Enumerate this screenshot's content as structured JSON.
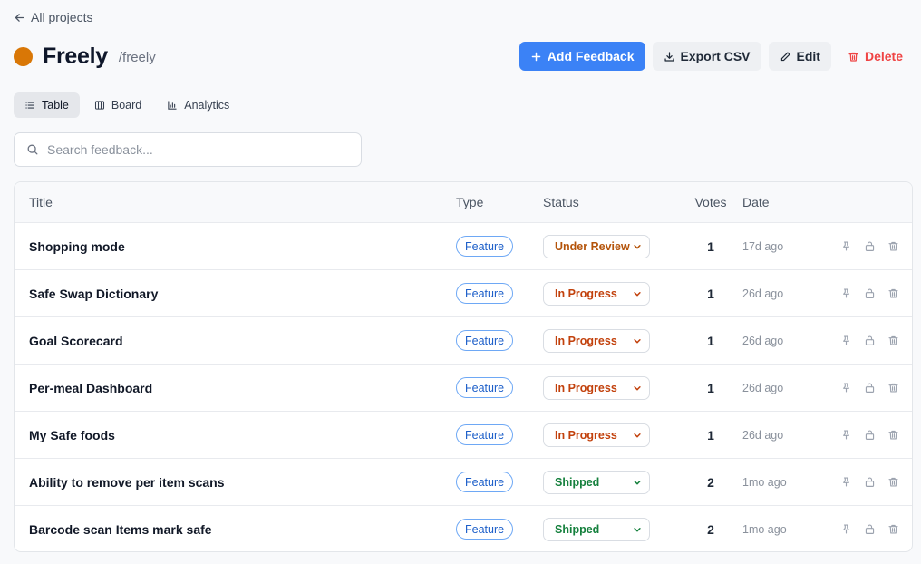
{
  "nav": {
    "back_label": "All projects"
  },
  "project": {
    "name": "Freely",
    "slug": "/freely",
    "color": "#d97706"
  },
  "actions": {
    "add_label": "Add Feedback",
    "export_label": "Export CSV",
    "edit_label": "Edit",
    "delete_label": "Delete"
  },
  "views": {
    "table": "Table",
    "board": "Board",
    "analytics": "Analytics",
    "active": "Table"
  },
  "search": {
    "placeholder": "Search feedback...",
    "value": ""
  },
  "table": {
    "headers": {
      "title": "Title",
      "type": "Type",
      "status": "Status",
      "votes": "Votes",
      "date": "Date"
    },
    "rows": [
      {
        "title": "Shopping mode",
        "type": "Feature",
        "status": "Under Review",
        "status_color": "#b45309",
        "votes": "1",
        "date": "17d ago"
      },
      {
        "title": "Safe Swap Dictionary",
        "type": "Feature",
        "status": "In Progress",
        "status_color": "#c2410c",
        "votes": "1",
        "date": "26d ago"
      },
      {
        "title": "Goal Scorecard",
        "type": "Feature",
        "status": "In Progress",
        "status_color": "#c2410c",
        "votes": "1",
        "date": "26d ago"
      },
      {
        "title": "Per-meal Dashboard",
        "type": "Feature",
        "status": "In Progress",
        "status_color": "#c2410c",
        "votes": "1",
        "date": "26d ago"
      },
      {
        "title": "My Safe foods",
        "type": "Feature",
        "status": "In Progress",
        "status_color": "#c2410c",
        "votes": "1",
        "date": "26d ago"
      },
      {
        "title": "Ability to remove per item scans",
        "type": "Feature",
        "status": "Shipped",
        "status_color": "#15803d",
        "votes": "2",
        "date": "1mo ago"
      },
      {
        "title": "Barcode scan Items mark safe",
        "type": "Feature",
        "status": "Shipped",
        "status_color": "#15803d",
        "votes": "2",
        "date": "1mo ago"
      }
    ]
  },
  "colors": {
    "primary": "#3b82f6",
    "danger": "#ef4444",
    "accent_dot": "#d97706"
  },
  "icons": {
    "back": "arrow-left-icon",
    "add": "plus-icon",
    "export": "download-icon",
    "edit": "pencil-icon",
    "delete": "trash-icon",
    "table": "list-icon",
    "board": "columns-icon",
    "analytics": "bar-chart-icon",
    "search": "search-icon",
    "pin": "pin-icon",
    "lock": "lock-icon",
    "row_delete": "trash-icon"
  }
}
